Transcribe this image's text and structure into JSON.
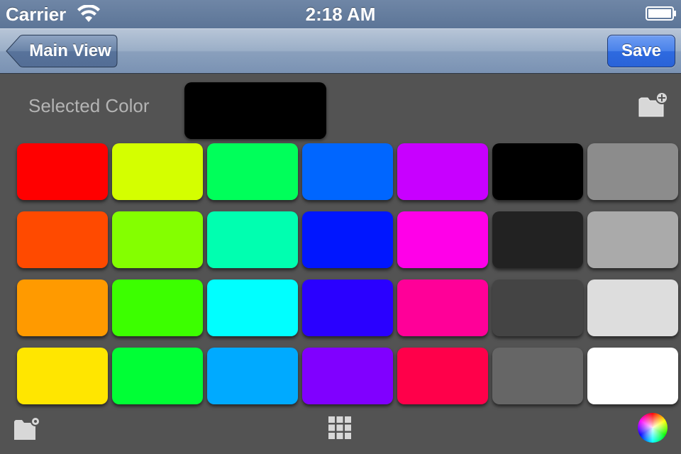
{
  "status_bar": {
    "carrier": "Carrier",
    "time": "2:18 AM",
    "wifi_icon": "wifi-icon",
    "battery_icon": "battery-icon"
  },
  "nav_bar": {
    "back_label": "Main View",
    "save_label": "Save",
    "save_color": "#2e6ae0",
    "bar_color": "#8aa0bd"
  },
  "content": {
    "selected_label": "Selected Color",
    "selected_color": "#000000",
    "add_folder_icon": "folder-add-icon"
  },
  "swatches": [
    [
      "#ff0000",
      "#d4ff00",
      "#00ff5a",
      "#0066ff",
      "#c800ff",
      "#000000",
      "#8c8c8c"
    ],
    [
      "#ff4a00",
      "#84ff00",
      "#00ffb0",
      "#0016ff",
      "#ff00e8",
      "#222222",
      "#aaaaaa"
    ],
    [
      "#ff9a00",
      "#3cff00",
      "#00ffff",
      "#2a00ff",
      "#ff0098",
      "#444444",
      "#dddddd"
    ],
    [
      "#ffe600",
      "#00ff35",
      "#00aaff",
      "#8000ff",
      "#ff004a",
      "#666666",
      "#ffffff"
    ]
  ],
  "toolbar": {
    "folder_settings_icon": "folder-settings-icon",
    "grid_icon": "grid-icon",
    "color_wheel_icon": "color-wheel-icon"
  }
}
